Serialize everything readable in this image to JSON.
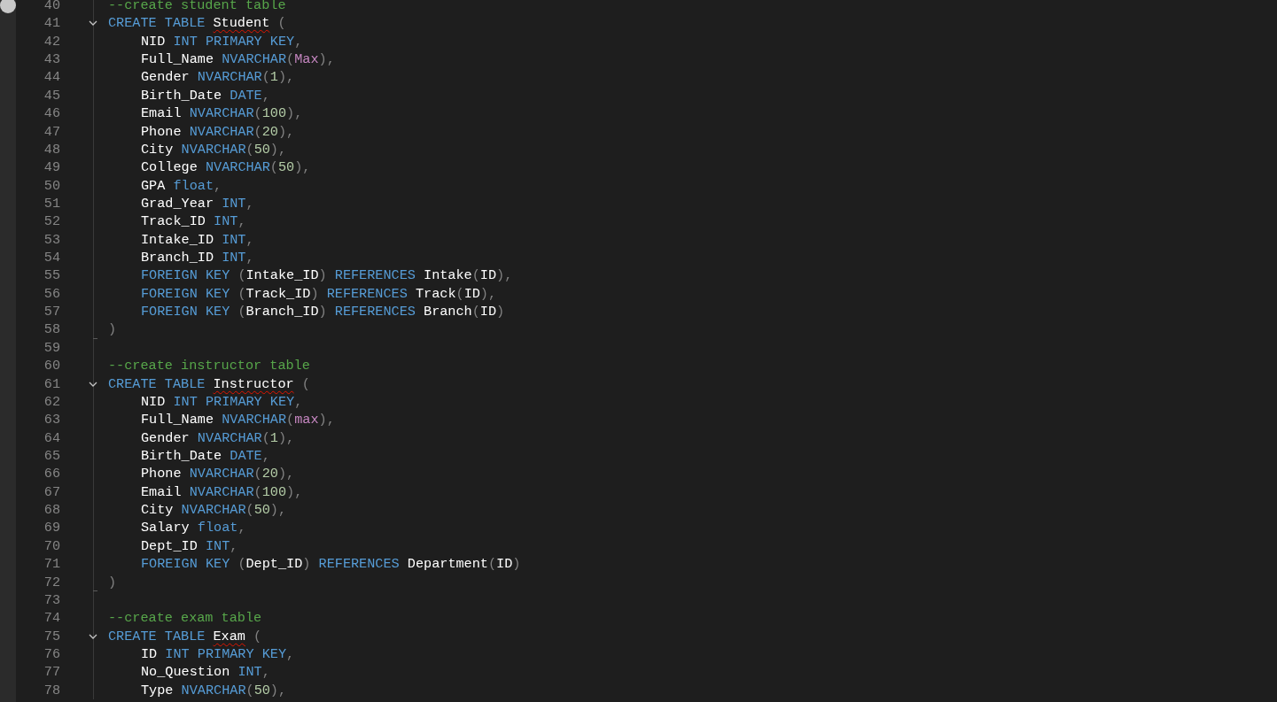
{
  "editor": {
    "lines": [
      {
        "number": "40",
        "tokens": [
          {
            "kind": "comment",
            "text": "--create student table"
          }
        ]
      },
      {
        "number": "41",
        "foldable": true,
        "tokens": [
          {
            "kind": "keyword",
            "text": "CREATE TABLE "
          },
          {
            "kind": "error",
            "text": "Student"
          },
          {
            "kind": "punct",
            "text": " ("
          }
        ]
      },
      {
        "number": "42",
        "indented": true,
        "tokens": [
          {
            "kind": "ident",
            "text": "NID "
          },
          {
            "kind": "keyword",
            "text": "INT PRIMARY KEY"
          },
          {
            "kind": "punct",
            "text": ","
          }
        ]
      },
      {
        "number": "43",
        "indented": true,
        "tokens": [
          {
            "kind": "ident",
            "text": "Full_Name "
          },
          {
            "kind": "keyword",
            "text": "NVARCHAR"
          },
          {
            "kind": "punct",
            "text": "("
          },
          {
            "kind": "func",
            "text": "Max"
          },
          {
            "kind": "punct",
            "text": "),"
          }
        ]
      },
      {
        "number": "44",
        "indented": true,
        "tokens": [
          {
            "kind": "ident",
            "text": "Gender "
          },
          {
            "kind": "keyword",
            "text": "NVARCHAR"
          },
          {
            "kind": "punct",
            "text": "("
          },
          {
            "kind": "number",
            "text": "1"
          },
          {
            "kind": "punct",
            "text": "),"
          }
        ]
      },
      {
        "number": "45",
        "indented": true,
        "tokens": [
          {
            "kind": "ident",
            "text": "Birth_Date "
          },
          {
            "kind": "keyword",
            "text": "DATE"
          },
          {
            "kind": "punct",
            "text": ","
          }
        ]
      },
      {
        "number": "46",
        "indented": true,
        "tokens": [
          {
            "kind": "ident",
            "text": "Email "
          },
          {
            "kind": "keyword",
            "text": "NVARCHAR"
          },
          {
            "kind": "punct",
            "text": "("
          },
          {
            "kind": "number",
            "text": "100"
          },
          {
            "kind": "punct",
            "text": "),"
          }
        ]
      },
      {
        "number": "47",
        "indented": true,
        "tokens": [
          {
            "kind": "ident",
            "text": "Phone "
          },
          {
            "kind": "keyword",
            "text": "NVARCHAR"
          },
          {
            "kind": "punct",
            "text": "("
          },
          {
            "kind": "number",
            "text": "20"
          },
          {
            "kind": "punct",
            "text": "),"
          }
        ]
      },
      {
        "number": "48",
        "indented": true,
        "tokens": [
          {
            "kind": "ident",
            "text": "City "
          },
          {
            "kind": "keyword",
            "text": "NVARCHAR"
          },
          {
            "kind": "punct",
            "text": "("
          },
          {
            "kind": "number",
            "text": "50"
          },
          {
            "kind": "punct",
            "text": "),"
          }
        ]
      },
      {
        "number": "49",
        "indented": true,
        "tokens": [
          {
            "kind": "ident",
            "text": "College "
          },
          {
            "kind": "keyword",
            "text": "NVARCHAR"
          },
          {
            "kind": "punct",
            "text": "("
          },
          {
            "kind": "number",
            "text": "50"
          },
          {
            "kind": "punct",
            "text": "),"
          }
        ]
      },
      {
        "number": "50",
        "indented": true,
        "tokens": [
          {
            "kind": "ident",
            "text": "GPA "
          },
          {
            "kind": "keyword",
            "text": "float"
          },
          {
            "kind": "punct",
            "text": ","
          }
        ]
      },
      {
        "number": "51",
        "indented": true,
        "tokens": [
          {
            "kind": "ident",
            "text": "Grad_Year "
          },
          {
            "kind": "keyword",
            "text": "INT"
          },
          {
            "kind": "punct",
            "text": ","
          }
        ]
      },
      {
        "number": "52",
        "indented": true,
        "tokens": [
          {
            "kind": "ident",
            "text": "Track_ID "
          },
          {
            "kind": "keyword",
            "text": "INT"
          },
          {
            "kind": "punct",
            "text": ","
          }
        ]
      },
      {
        "number": "53",
        "indented": true,
        "tokens": [
          {
            "kind": "ident",
            "text": "Intake_ID "
          },
          {
            "kind": "keyword",
            "text": "INT"
          },
          {
            "kind": "punct",
            "text": ","
          }
        ]
      },
      {
        "number": "54",
        "indented": true,
        "tokens": [
          {
            "kind": "ident",
            "text": "Branch_ID "
          },
          {
            "kind": "keyword",
            "text": "INT"
          },
          {
            "kind": "punct",
            "text": ","
          }
        ]
      },
      {
        "number": "55",
        "indented": true,
        "tokens": [
          {
            "kind": "keyword",
            "text": "FOREIGN KEY "
          },
          {
            "kind": "punct",
            "text": "("
          },
          {
            "kind": "ident",
            "text": "Intake_ID"
          },
          {
            "kind": "punct",
            "text": ") "
          },
          {
            "kind": "keyword",
            "text": "REFERENCES "
          },
          {
            "kind": "ident",
            "text": "Intake"
          },
          {
            "kind": "punct",
            "text": "("
          },
          {
            "kind": "ident",
            "text": "ID"
          },
          {
            "kind": "punct",
            "text": "),"
          }
        ]
      },
      {
        "number": "56",
        "indented": true,
        "tokens": [
          {
            "kind": "keyword",
            "text": "FOREIGN KEY "
          },
          {
            "kind": "punct",
            "text": "("
          },
          {
            "kind": "ident",
            "text": "Track_ID"
          },
          {
            "kind": "punct",
            "text": ") "
          },
          {
            "kind": "keyword",
            "text": "REFERENCES "
          },
          {
            "kind": "ident",
            "text": "Track"
          },
          {
            "kind": "punct",
            "text": "("
          },
          {
            "kind": "ident",
            "text": "ID"
          },
          {
            "kind": "punct",
            "text": "),"
          }
        ]
      },
      {
        "number": "57",
        "indented": true,
        "tokens": [
          {
            "kind": "keyword",
            "text": "FOREIGN KEY "
          },
          {
            "kind": "punct",
            "text": "("
          },
          {
            "kind": "ident",
            "text": "Branch_ID"
          },
          {
            "kind": "punct",
            "text": ") "
          },
          {
            "kind": "keyword",
            "text": "REFERENCES "
          },
          {
            "kind": "ident",
            "text": "Branch"
          },
          {
            "kind": "punct",
            "text": "("
          },
          {
            "kind": "ident",
            "text": "ID"
          },
          {
            "kind": "punct",
            "text": ")"
          }
        ]
      },
      {
        "number": "58",
        "fold_end": true,
        "tokens": [
          {
            "kind": "punct",
            "text": ")"
          }
        ]
      },
      {
        "number": "59"
      },
      {
        "number": "60",
        "tokens": [
          {
            "kind": "comment",
            "text": "--create instructor table"
          }
        ]
      },
      {
        "number": "61",
        "foldable": true,
        "tokens": [
          {
            "kind": "keyword",
            "text": "CREATE TABLE "
          },
          {
            "kind": "error",
            "text": "Instructor"
          },
          {
            "kind": "punct",
            "text": " ("
          }
        ]
      },
      {
        "number": "62",
        "indented": true,
        "tokens": [
          {
            "kind": "ident",
            "text": "NID "
          },
          {
            "kind": "keyword",
            "text": "INT PRIMARY KEY"
          },
          {
            "kind": "punct",
            "text": ","
          }
        ]
      },
      {
        "number": "63",
        "indented": true,
        "tokens": [
          {
            "kind": "ident",
            "text": "Full_Name "
          },
          {
            "kind": "keyword",
            "text": "NVARCHAR"
          },
          {
            "kind": "punct",
            "text": "("
          },
          {
            "kind": "func",
            "text": "max"
          },
          {
            "kind": "punct",
            "text": "),"
          }
        ]
      },
      {
        "number": "64",
        "indented": true,
        "tokens": [
          {
            "kind": "ident",
            "text": "Gender "
          },
          {
            "kind": "keyword",
            "text": "NVARCHAR"
          },
          {
            "kind": "punct",
            "text": "("
          },
          {
            "kind": "number",
            "text": "1"
          },
          {
            "kind": "punct",
            "text": "),"
          }
        ]
      },
      {
        "number": "65",
        "indented": true,
        "tokens": [
          {
            "kind": "ident",
            "text": "Birth_Date "
          },
          {
            "kind": "keyword",
            "text": "DATE"
          },
          {
            "kind": "punct",
            "text": ","
          }
        ]
      },
      {
        "number": "66",
        "indented": true,
        "tokens": [
          {
            "kind": "ident",
            "text": "Phone "
          },
          {
            "kind": "keyword",
            "text": "NVARCHAR"
          },
          {
            "kind": "punct",
            "text": "("
          },
          {
            "kind": "number",
            "text": "20"
          },
          {
            "kind": "punct",
            "text": "),"
          }
        ]
      },
      {
        "number": "67",
        "indented": true,
        "tokens": [
          {
            "kind": "ident",
            "text": "Email "
          },
          {
            "kind": "keyword",
            "text": "NVARCHAR"
          },
          {
            "kind": "punct",
            "text": "("
          },
          {
            "kind": "number",
            "text": "100"
          },
          {
            "kind": "punct",
            "text": "),"
          }
        ]
      },
      {
        "number": "68",
        "indented": true,
        "tokens": [
          {
            "kind": "ident",
            "text": "City "
          },
          {
            "kind": "keyword",
            "text": "NVARCHAR"
          },
          {
            "kind": "punct",
            "text": "("
          },
          {
            "kind": "number",
            "text": "50"
          },
          {
            "kind": "punct",
            "text": "),"
          }
        ]
      },
      {
        "number": "69",
        "indented": true,
        "tokens": [
          {
            "kind": "ident",
            "text": "Salary "
          },
          {
            "kind": "keyword",
            "text": "float"
          },
          {
            "kind": "punct",
            "text": ","
          }
        ]
      },
      {
        "number": "70",
        "indented": true,
        "tokens": [
          {
            "kind": "ident",
            "text": "Dept_ID "
          },
          {
            "kind": "keyword",
            "text": "INT"
          },
          {
            "kind": "punct",
            "text": ","
          }
        ]
      },
      {
        "number": "71",
        "indented": true,
        "tokens": [
          {
            "kind": "keyword",
            "text": "FOREIGN KEY "
          },
          {
            "kind": "punct",
            "text": "("
          },
          {
            "kind": "ident",
            "text": "Dept_ID"
          },
          {
            "kind": "punct",
            "text": ") "
          },
          {
            "kind": "keyword",
            "text": "REFERENCES "
          },
          {
            "kind": "ident",
            "text": "Department"
          },
          {
            "kind": "punct",
            "text": "("
          },
          {
            "kind": "ident",
            "text": "ID"
          },
          {
            "kind": "punct",
            "text": ")"
          }
        ]
      },
      {
        "number": "72",
        "fold_end": true,
        "tokens": [
          {
            "kind": "punct",
            "text": ")"
          }
        ]
      },
      {
        "number": "73"
      },
      {
        "number": "74",
        "tokens": [
          {
            "kind": "comment",
            "text": "--create exam table"
          }
        ]
      },
      {
        "number": "75",
        "foldable": true,
        "tokens": [
          {
            "kind": "keyword",
            "text": "CREATE TABLE "
          },
          {
            "kind": "error",
            "text": "Exam"
          },
          {
            "kind": "punct",
            "text": " ("
          }
        ]
      },
      {
        "number": "76",
        "indented": true,
        "tokens": [
          {
            "kind": "ident",
            "text": "ID "
          },
          {
            "kind": "keyword",
            "text": "INT PRIMARY KEY"
          },
          {
            "kind": "punct",
            "text": ","
          }
        ]
      },
      {
        "number": "77",
        "indented": true,
        "tokens": [
          {
            "kind": "ident",
            "text": "No_Question "
          },
          {
            "kind": "keyword",
            "text": "INT"
          },
          {
            "kind": "punct",
            "text": ","
          }
        ]
      },
      {
        "number": "78",
        "indented": true,
        "tokens": [
          {
            "kind": "ident",
            "text": "Type "
          },
          {
            "kind": "keyword",
            "text": "NVARCHAR"
          },
          {
            "kind": "punct",
            "text": "("
          },
          {
            "kind": "number",
            "text": "50"
          },
          {
            "kind": "punct",
            "text": "),"
          }
        ]
      }
    ]
  }
}
